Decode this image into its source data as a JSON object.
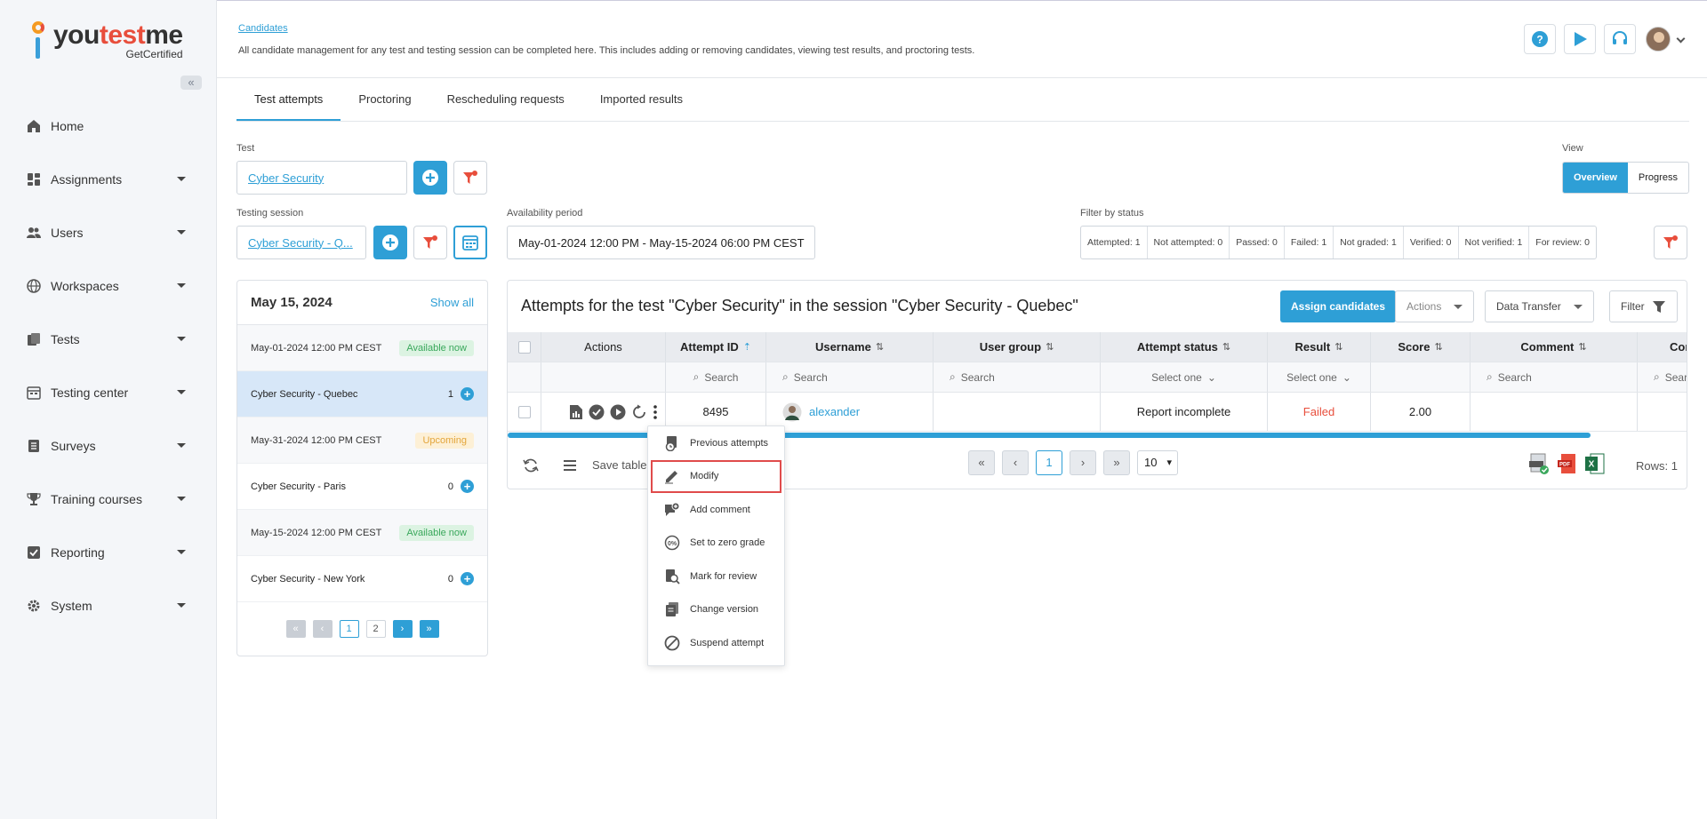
{
  "brand": {
    "name_a": "you",
    "name_b": "test",
    "name_c": "me",
    "sub": "GetCertified"
  },
  "sidebar": {
    "items": [
      {
        "label": "Home",
        "icon": "home-icon"
      },
      {
        "label": "Assignments",
        "icon": "assignments-icon"
      },
      {
        "label": "Users",
        "icon": "users-icon"
      },
      {
        "label": "Workspaces",
        "icon": "globe-icon"
      },
      {
        "label": "Tests",
        "icon": "tests-icon"
      },
      {
        "label": "Testing center",
        "icon": "calendar-icon"
      },
      {
        "label": "Surveys",
        "icon": "surveys-icon"
      },
      {
        "label": "Training courses",
        "icon": "trophy-icon"
      },
      {
        "label": "Reporting",
        "icon": "reporting-icon"
      },
      {
        "label": "System",
        "icon": "gear-icon"
      }
    ]
  },
  "header": {
    "breadcrumb": "Candidates",
    "description": "All candidate management for any test and testing session can be completed here. This includes adding or removing candidates, viewing test results, and proctoring tests."
  },
  "tabs": [
    "Test attempts",
    "Proctoring",
    "Rescheduling requests",
    "Imported results"
  ],
  "form": {
    "test_label": "Test",
    "test_value": "Cyber Security",
    "session_label": "Testing session",
    "session_value": "Cyber Security - Q...",
    "availability_label": "Availability period",
    "availability_value": "May-01-2024 12:00 PM - May-15-2024 06:00 PM CEST",
    "filter_status_label": "Filter by status",
    "view_label": "View",
    "view_overview": "Overview",
    "view_progress": "Progress",
    "status_filters": [
      "Attempted: 1",
      "Not attempted: 0",
      "Passed: 0",
      "Failed: 1",
      "Not graded: 1",
      "Verified: 0",
      "Not verified: 1",
      "For review: 0"
    ]
  },
  "sessions": {
    "date": "May 15, 2024",
    "show_all": "Show all",
    "rows": [
      {
        "type": "date",
        "text": "May-01-2024 12:00 PM CEST",
        "badge": "Available now"
      },
      {
        "type": "session",
        "text": "Cyber Security - Quebec",
        "count": "1"
      },
      {
        "type": "date",
        "text": "May-31-2024 12:00 PM CEST",
        "badge": "Upcoming"
      },
      {
        "type": "session",
        "text": "Cyber Security - Paris",
        "count": "0"
      },
      {
        "type": "date",
        "text": "May-15-2024 12:00 PM CEST",
        "badge": "Available now"
      },
      {
        "type": "session",
        "text": "Cyber Security - New York",
        "count": "0"
      }
    ],
    "pages": [
      "1",
      "2"
    ]
  },
  "table": {
    "title": "Attempts for the test \"Cyber Security\" in the session \"Cyber Security - Quebec\"",
    "assign_btn": "Assign candidates",
    "actions_btn": "Actions",
    "transfer_btn": "Data Transfer",
    "filter_btn": "Filter",
    "columns": [
      "Actions",
      "Attempt ID",
      "Username",
      "User group",
      "Attempt status",
      "Result",
      "Score",
      "Comment",
      "Comm"
    ],
    "search_placeholder": "Search",
    "select_placeholder": "Select one",
    "row": {
      "attempt_id": "8495",
      "username": "alexander",
      "user_group": "",
      "status": "Report incomplete",
      "result": "Failed",
      "score": "2.00",
      "comment": ""
    },
    "save_table": "Save table",
    "page": "1",
    "page_size": "10",
    "rows_label": "Rows: 1"
  },
  "context_menu": [
    {
      "label": "Previous attempts",
      "icon": "history-icon"
    },
    {
      "label": "Modify",
      "icon": "edit-icon"
    },
    {
      "label": "Add comment",
      "icon": "comment-icon"
    },
    {
      "label": "Set to zero grade",
      "icon": "zero-grade-icon"
    },
    {
      "label": "Mark for review",
      "icon": "review-icon"
    },
    {
      "label": "Change version",
      "icon": "version-icon"
    },
    {
      "label": "Suspend attempt",
      "icon": "suspend-icon"
    }
  ],
  "colors": {
    "accent": "#2e9fd6",
    "danger": "#e84e3c",
    "success": "#3aa85c",
    "warning": "#e3a53a"
  }
}
